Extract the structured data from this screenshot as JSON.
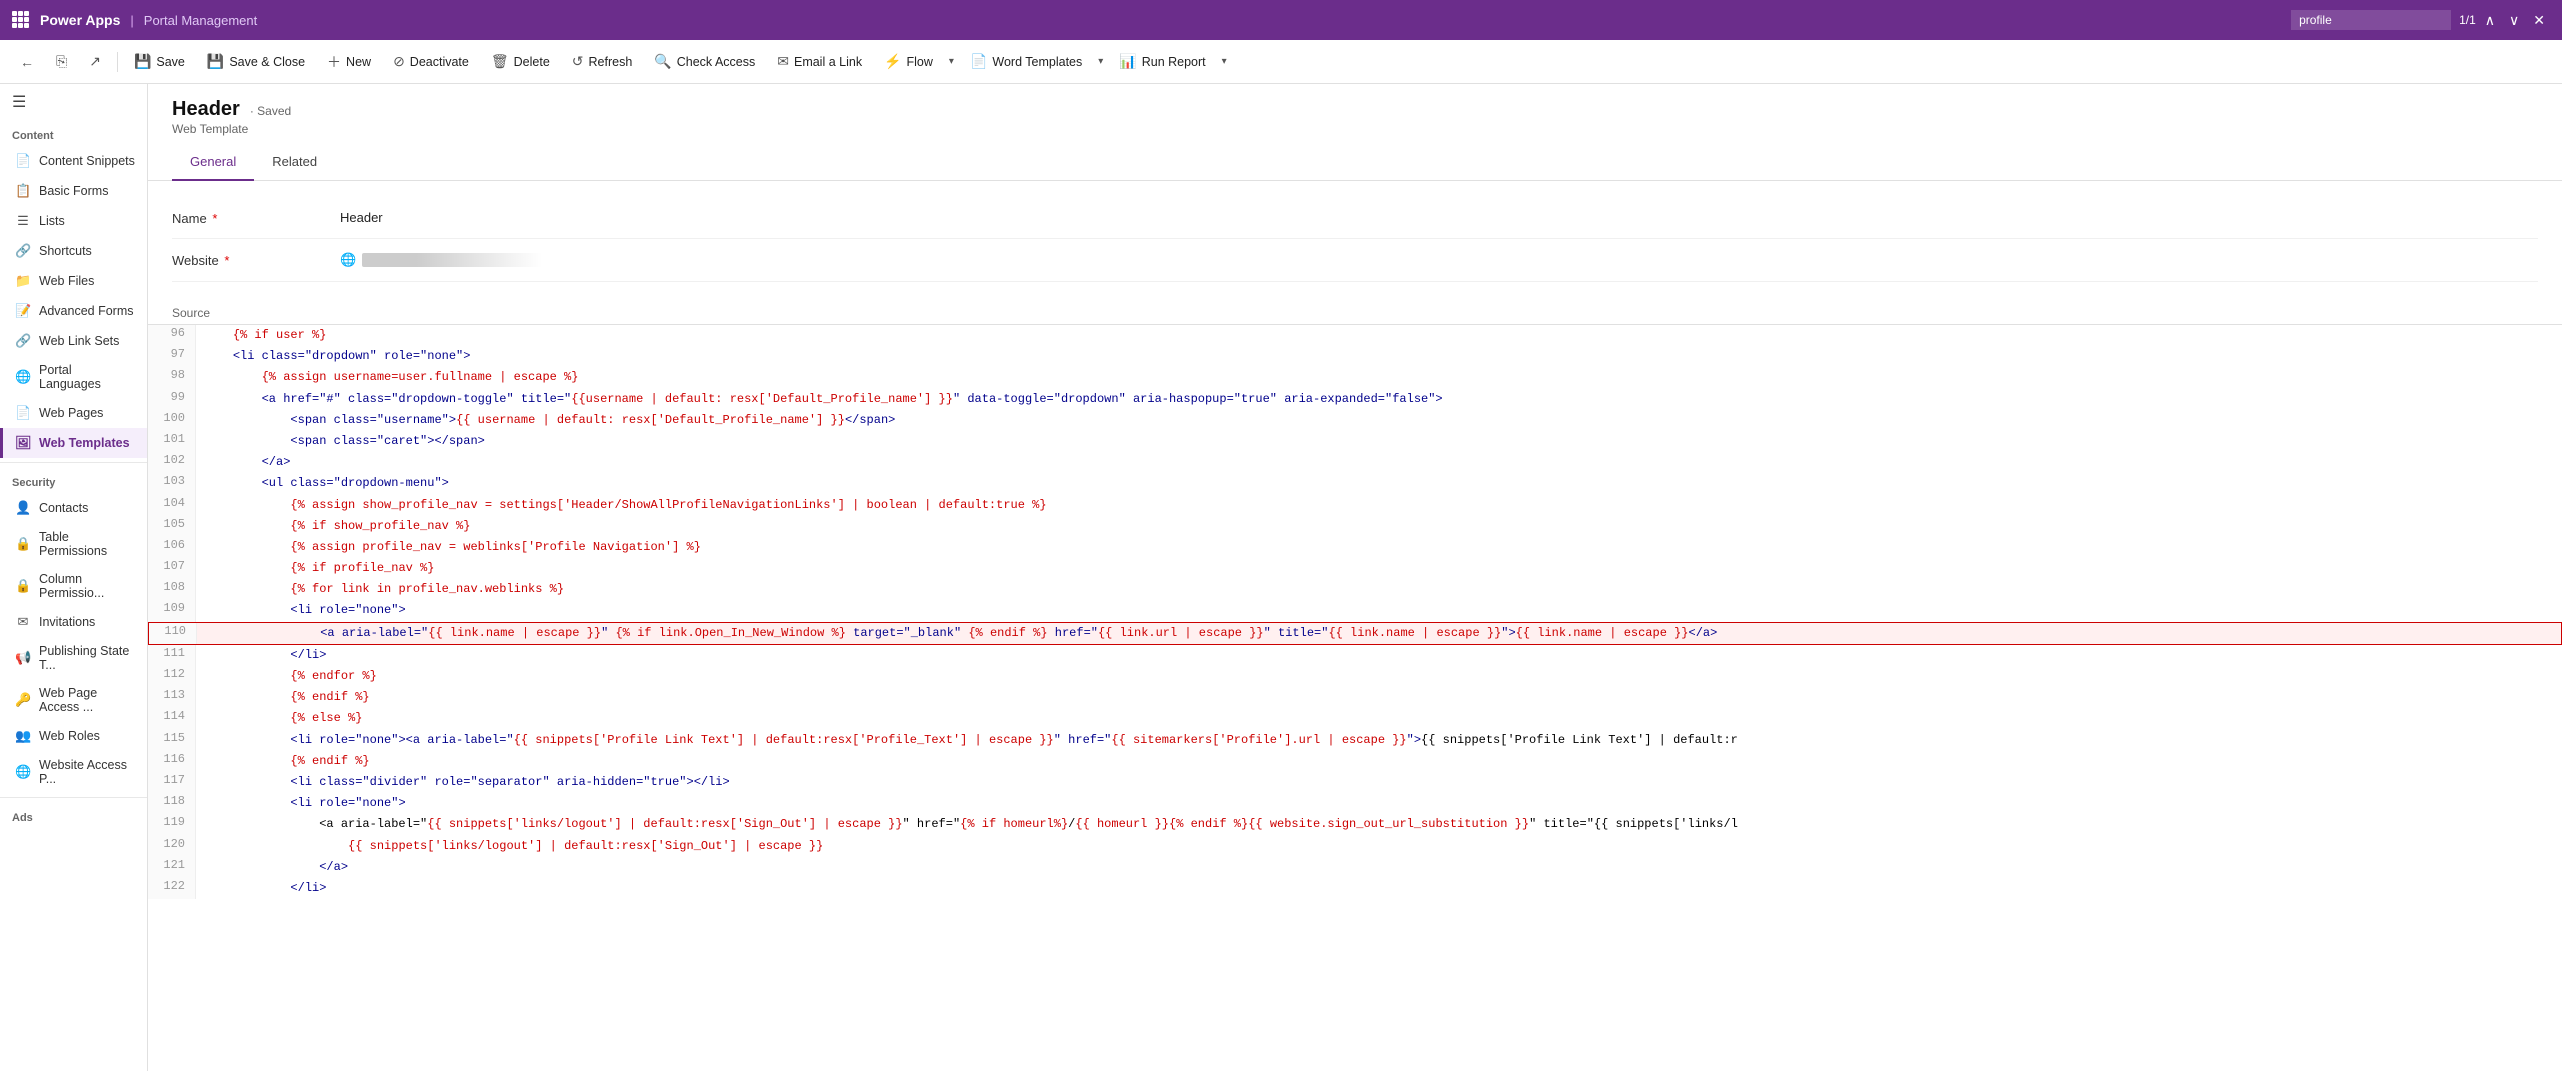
{
  "topBar": {
    "appName": "Power Apps",
    "separator": "|",
    "portalName": "Portal Management",
    "searchPlaceholder": "profile",
    "searchValue": "profile",
    "pageIndicator": "1/1"
  },
  "toolbar": {
    "backLabel": "←",
    "saveLabel": "Save",
    "saveCloseLabel": "Save & Close",
    "newLabel": "New",
    "deactivateLabel": "Deactivate",
    "deleteLabel": "Delete",
    "refreshLabel": "Refresh",
    "checkAccessLabel": "Check Access",
    "emailLinkLabel": "Email a Link",
    "flowLabel": "Flow",
    "wordTemplatesLabel": "Word Templates",
    "runReportLabel": "Run Report"
  },
  "sidebar": {
    "contentLabel": "Content",
    "items": [
      {
        "id": "content-snippets",
        "label": "Content Snippets",
        "icon": "📄"
      },
      {
        "id": "basic-forms",
        "label": "Basic Forms",
        "icon": "📋"
      },
      {
        "id": "lists",
        "label": "Lists",
        "icon": "☰"
      },
      {
        "id": "shortcuts",
        "label": "Shortcuts",
        "icon": "🔗"
      },
      {
        "id": "web-files",
        "label": "Web Files",
        "icon": "📁"
      },
      {
        "id": "advanced-forms",
        "label": "Advanced Forms",
        "icon": "📝"
      },
      {
        "id": "web-link-sets",
        "label": "Web Link Sets",
        "icon": "🔗"
      },
      {
        "id": "portal-languages",
        "label": "Portal Languages",
        "icon": "🌐"
      },
      {
        "id": "web-pages",
        "label": "Web Pages",
        "icon": "📄"
      },
      {
        "id": "web-templates",
        "label": "Web Templates",
        "icon": "🖼️",
        "active": true
      }
    ],
    "securityLabel": "Security",
    "securityItems": [
      {
        "id": "contacts",
        "label": "Contacts",
        "icon": "👤"
      },
      {
        "id": "table-permissions",
        "label": "Table Permissions",
        "icon": "🔒"
      },
      {
        "id": "column-permissions",
        "label": "Column Permissio...",
        "icon": "🔒"
      },
      {
        "id": "invitations",
        "label": "Invitations",
        "icon": "✉️"
      },
      {
        "id": "publishing-state",
        "label": "Publishing State T...",
        "icon": "📢"
      },
      {
        "id": "web-page-access",
        "label": "Web Page Access ...",
        "icon": "🔑"
      },
      {
        "id": "web-roles",
        "label": "Web Roles",
        "icon": "👥"
      },
      {
        "id": "website-access",
        "label": "Website Access P...",
        "icon": "🌐"
      }
    ],
    "adsLabel": "Ads"
  },
  "record": {
    "title": "Header",
    "savedStatus": "Saved",
    "subtitle": "Web Template",
    "tabs": [
      "General",
      "Related"
    ],
    "activeTab": "General"
  },
  "form": {
    "nameLabel": "Name",
    "nameRequired": "*",
    "nameValue": "Header",
    "websiteLabel": "Website",
    "websiteRequired": "*"
  },
  "sourceLabel": "Source",
  "codeLines": [
    {
      "num": "96",
      "code": "    {% if user %}",
      "highlight": false
    },
    {
      "num": "97",
      "code": "    <li class=\"dropdown\" role=\"none\">",
      "highlight": false
    },
    {
      "num": "98",
      "code": "        {% assign username=user.fullname | escape %}",
      "highlight": false
    },
    {
      "num": "99",
      "code": "        <a href=\"#\" class=\"dropdown-toggle\" title=\"{{username | default: resx['Default_Profile_name'] }}\" data-toggle=\"dropdown\" aria-haspopup=\"true\" aria-expanded=\"false\">",
      "highlight": false
    },
    {
      "num": "100",
      "code": "            <span class=\"username\">{{ username | default: resx['Default_Profile_name'] }}</span>",
      "highlight": false
    },
    {
      "num": "101",
      "code": "            <span class=\"caret\"></span>",
      "highlight": false
    },
    {
      "num": "102",
      "code": "        </a>",
      "highlight": false
    },
    {
      "num": "103",
      "code": "        <ul class=\"dropdown-menu\">",
      "highlight": false
    },
    {
      "num": "104",
      "code": "            {% assign show_profile_nav = settings['Header/ShowAllProfileNavigationLinks'] | boolean | default:true %}",
      "highlight": false
    },
    {
      "num": "105",
      "code": "            {% if show_profile_nav %}",
      "highlight": false
    },
    {
      "num": "106",
      "code": "            {% assign profile_nav = weblinks['Profile Navigation'] %}",
      "highlight": false
    },
    {
      "num": "107",
      "code": "            {% if profile_nav %}",
      "highlight": false
    },
    {
      "num": "108",
      "code": "            {% for link in profile_nav.weblinks %}",
      "highlight": false
    },
    {
      "num": "109",
      "code": "            <li role=\"none\">",
      "highlight": false
    },
    {
      "num": "110",
      "code": "                <a aria-label=\"{{ link.name | escape }}\" {% if link.Open_In_New_Window %} target=\"_blank\" {% endif %} href=\"{{ link.url | escape }}\" title=\"{{ link.name | escape }}\">{{ link.name | escape }}</a>",
      "highlight": true
    },
    {
      "num": "111",
      "code": "            </li>",
      "highlight": false
    },
    {
      "num": "112",
      "code": "            {% endfor %}",
      "highlight": false
    },
    {
      "num": "113",
      "code": "            {% endif %}",
      "highlight": false
    },
    {
      "num": "114",
      "code": "            {% else %}",
      "highlight": false
    },
    {
      "num": "115",
      "code": "            <li role=\"none\"><a aria-label=\"{{ snippets['Profile Link Text'] | default:resx['Profile_Text'] | escape }}\" href=\"{{ sitemarkers['Profile'].url | escape }}\">{{ snippets['Profile Link Text'] | default:r",
      "highlight": false
    },
    {
      "num": "116",
      "code": "            {% endif %}",
      "highlight": false
    },
    {
      "num": "117",
      "code": "            <li class=\"divider\" role=\"separator\" aria-hidden=\"true\"></li>",
      "highlight": false
    },
    {
      "num": "118",
      "code": "            <li role=\"none\">",
      "highlight": false
    },
    {
      "num": "119",
      "code": "                <a aria-label=\"{{ snippets['links/logout'] | default:resx['Sign_Out'] | escape }}\" href=\"{% if homeurl%}/{{ homeurl }}{% endif %}{{ website.sign_out_url_substitution }}\" title=\"{{ snippets['links/l",
      "highlight": false
    },
    {
      "num": "120",
      "code": "                    {{ snippets['links/logout'] | default:resx['Sign_Out'] | escape }}",
      "highlight": false
    },
    {
      "num": "121",
      "code": "                </a>",
      "highlight": false
    },
    {
      "num": "122",
      "code": "            </li>",
      "highlight": false
    }
  ]
}
